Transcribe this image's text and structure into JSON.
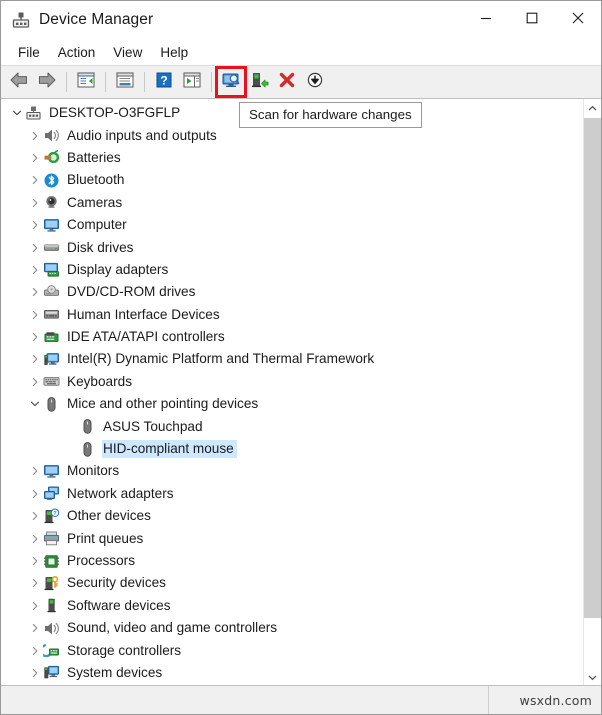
{
  "window": {
    "title": "Device Manager",
    "icon": "device-manager-icon",
    "caption_buttons": [
      {
        "name": "minimize",
        "glyph": "minimize-icon"
      },
      {
        "name": "maximize",
        "glyph": "maximize-icon"
      },
      {
        "name": "close",
        "glyph": "close-icon"
      }
    ]
  },
  "menubar": {
    "items": [
      {
        "label": "File"
      },
      {
        "label": "Action"
      },
      {
        "label": "View"
      },
      {
        "label": "Help"
      }
    ]
  },
  "toolbar": {
    "buttons": [
      {
        "name": "back-button",
        "icon": "back-arrow-icon",
        "highlighted": false
      },
      {
        "name": "forward-button",
        "icon": "forward-arrow-icon",
        "highlighted": false
      },
      {
        "name": "show-hide-console-tree-button",
        "icon": "console-tree-icon",
        "highlighted": false
      },
      {
        "name": "properties-button",
        "icon": "properties-icon",
        "highlighted": false
      },
      {
        "name": "help-button",
        "icon": "help-question-icon",
        "highlighted": false
      },
      {
        "name": "show-hide-action-pane-button",
        "icon": "action-pane-icon",
        "highlighted": false
      },
      {
        "name": "scan-for-hardware-changes-button",
        "icon": "scan-hardware-icon",
        "highlighted": true
      },
      {
        "name": "update-driver-button",
        "icon": "update-driver-icon",
        "highlighted": false
      },
      {
        "name": "uninstall-device-button",
        "icon": "red-x-icon",
        "highlighted": false
      },
      {
        "name": "disable-device-button",
        "icon": "down-arrow-circle-icon",
        "highlighted": false
      }
    ],
    "highlight_color": "#e8111f"
  },
  "tooltip": {
    "text": "Scan for hardware changes",
    "visible": true
  },
  "tree": {
    "selection_color": "#cde8ff",
    "rows": [
      {
        "label": "DESKTOP-O3FGFLP",
        "level": 0,
        "state": "expanded",
        "icon": "computer-root-icon",
        "selected": false
      },
      {
        "label": "Audio inputs and outputs",
        "level": 1,
        "state": "collapsed",
        "icon": "speaker-icon",
        "selected": false
      },
      {
        "label": "Batteries",
        "level": 1,
        "state": "collapsed",
        "icon": "battery-icon",
        "selected": false
      },
      {
        "label": "Bluetooth",
        "level": 1,
        "state": "collapsed",
        "icon": "bluetooth-icon",
        "selected": false
      },
      {
        "label": "Cameras",
        "level": 1,
        "state": "collapsed",
        "icon": "camera-icon",
        "selected": false
      },
      {
        "label": "Computer",
        "level": 1,
        "state": "collapsed",
        "icon": "monitor-icon",
        "selected": false
      },
      {
        "label": "Disk drives",
        "level": 1,
        "state": "collapsed",
        "icon": "disk-drive-icon",
        "selected": false
      },
      {
        "label": "Display adapters",
        "level": 1,
        "state": "collapsed",
        "icon": "display-adapter-icon",
        "selected": false
      },
      {
        "label": "DVD/CD-ROM drives",
        "level": 1,
        "state": "collapsed",
        "icon": "dvd-drive-icon",
        "selected": false
      },
      {
        "label": "Human Interface Devices",
        "level": 1,
        "state": "collapsed",
        "icon": "hid-icon",
        "selected": false
      },
      {
        "label": "IDE ATA/ATAPI controllers",
        "level": 1,
        "state": "collapsed",
        "icon": "ide-controller-icon",
        "selected": false
      },
      {
        "label": "Intel(R) Dynamic Platform and Thermal Framework",
        "level": 1,
        "state": "collapsed",
        "icon": "thermal-framework-icon",
        "selected": false
      },
      {
        "label": "Keyboards",
        "level": 1,
        "state": "collapsed",
        "icon": "keyboard-icon",
        "selected": false
      },
      {
        "label": "Mice and other pointing devices",
        "level": 1,
        "state": "expanded",
        "icon": "mouse-icon",
        "selected": false
      },
      {
        "label": "ASUS Touchpad",
        "level": 2,
        "state": "leaf",
        "icon": "mouse-icon",
        "selected": false
      },
      {
        "label": "HID-compliant mouse",
        "level": 2,
        "state": "leaf",
        "icon": "mouse-icon",
        "selected": true
      },
      {
        "label": "Monitors",
        "level": 1,
        "state": "collapsed",
        "icon": "monitor-icon",
        "selected": false
      },
      {
        "label": "Network adapters",
        "level": 1,
        "state": "collapsed",
        "icon": "network-adapter-icon",
        "selected": false
      },
      {
        "label": "Other devices",
        "level": 1,
        "state": "collapsed",
        "icon": "other-device-icon",
        "selected": false
      },
      {
        "label": "Print queues",
        "level": 1,
        "state": "collapsed",
        "icon": "printer-icon",
        "selected": false
      },
      {
        "label": "Processors",
        "level": 1,
        "state": "collapsed",
        "icon": "processor-icon",
        "selected": false
      },
      {
        "label": "Security devices",
        "level": 1,
        "state": "collapsed",
        "icon": "security-device-icon",
        "selected": false
      },
      {
        "label": "Software devices",
        "level": 1,
        "state": "collapsed",
        "icon": "software-device-icon",
        "selected": false
      },
      {
        "label": "Sound, video and game controllers",
        "level": 1,
        "state": "collapsed",
        "icon": "speaker-icon",
        "selected": false
      },
      {
        "label": "Storage controllers",
        "level": 1,
        "state": "collapsed",
        "icon": "storage-controller-icon",
        "selected": false
      },
      {
        "label": "System devices",
        "level": 1,
        "state": "collapsed",
        "icon": "system-device-icon",
        "selected": false
      }
    ]
  },
  "scrollbar": {
    "up_arrow": "chevron-up-icon",
    "down_arrow": "chevron-down-icon"
  },
  "statusbar": {
    "left_text": "",
    "watermark": "wsxdn.com"
  }
}
